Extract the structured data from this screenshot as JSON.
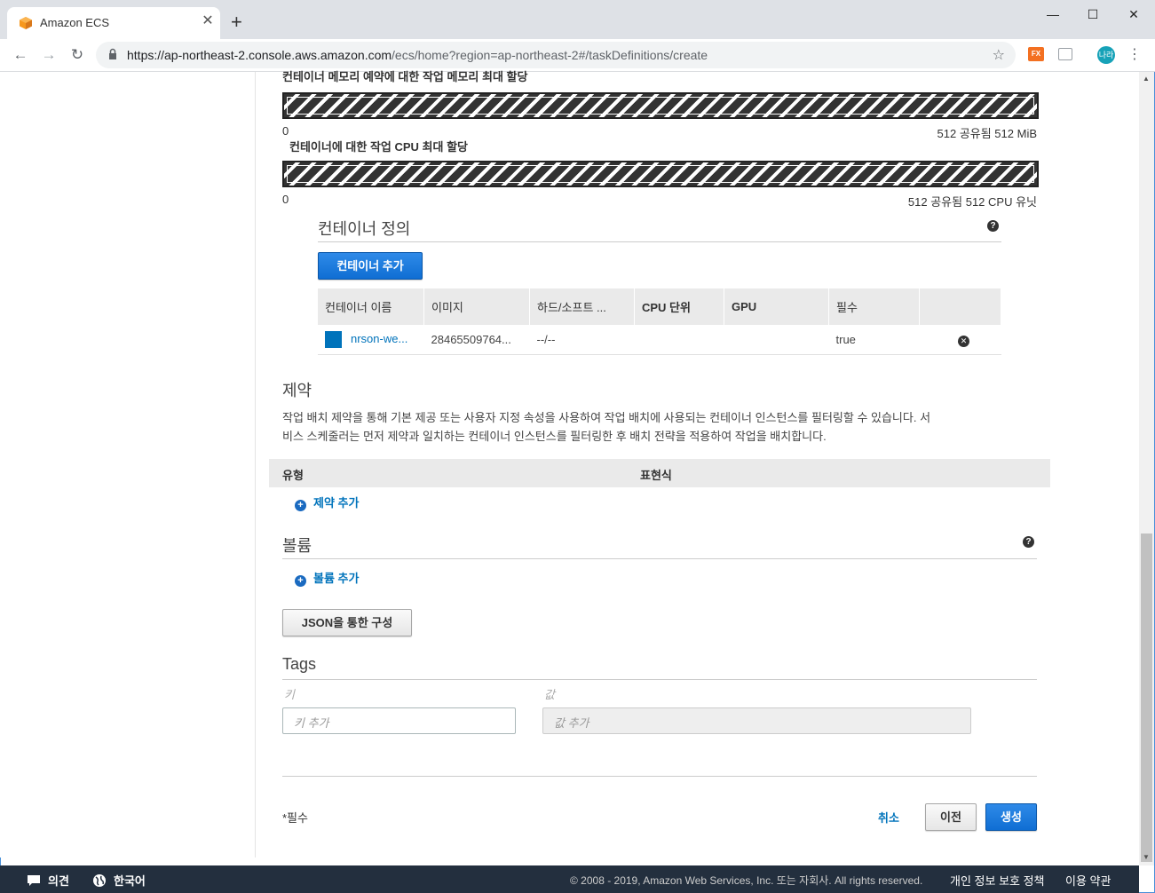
{
  "browser": {
    "tab_title": "Amazon ECS",
    "url_host": "https://ap-northeast-2.console.aws.amazon.com",
    "url_path": "/ecs/home?region=ap-northeast-2#/taskDefinitions/create",
    "ext_label": "FX",
    "avatar_label": "나라"
  },
  "memory": {
    "label": "컨테이너 메모리 예약에 대한 작업 메모리 최대 할당",
    "min": "0",
    "max": "512 공유됨 512 MiB"
  },
  "cpu": {
    "label": "컨테이너에 대한 작업 CPU 최대 할당",
    "min": "0",
    "max": "512 공유됨 512 CPU 유닛"
  },
  "containers": {
    "title": "컨테이너 정의",
    "add_button": "컨테이너 추가",
    "columns": [
      "컨테이너 이름",
      "이미지",
      "하드/소프트 ...",
      "CPU 단위",
      "GPU",
      "필수",
      ""
    ],
    "rows": [
      {
        "name": "nrson-we...",
        "image": "28465509764...",
        "limits": "--/--",
        "cpu": "",
        "gpu": "",
        "essential": "true"
      }
    ]
  },
  "constraints": {
    "title": "제약",
    "description_1": "작업 배치 제약을 통해 기본 제공 또는 사용자 지정 속성을 사용하여 작업 배치에 사용되는 컨테이너 인스턴스를 필터링할 수 있습니다. 서",
    "description_2": "비스 스케줄러는 먼저 제약과 일치하는 컨테이너 인스턴스를 필터링한 후 배치 전략을 적용하여 작업을 배치합니다.",
    "col_type": "유형",
    "col_expression": "표현식",
    "add_link": "제약 추가"
  },
  "volumes": {
    "title": "볼륨",
    "add_link": "볼륨 추가"
  },
  "json_button": "JSON을 통한 구성",
  "tags": {
    "title": "Tags",
    "key_label": "키",
    "value_label": "값",
    "key_placeholder": "키 추가",
    "value_placeholder": "값 추가"
  },
  "form_footer": {
    "required_note": "*필수",
    "cancel": "취소",
    "previous": "이전",
    "create": "생성"
  },
  "footer": {
    "feedback": "의견",
    "language": "한국어",
    "copyright": "© 2008 - 2019, Amazon Web Services, Inc. 또는 자회사. All rights reserved.",
    "privacy": "개인 정보 보호 정책",
    "terms": "이용 약관"
  },
  "colors": {
    "primary_button": "#0f6ed3",
    "link": "#0073bb",
    "footer_bg": "#232f3e",
    "container_swatch": "#0073bb"
  }
}
